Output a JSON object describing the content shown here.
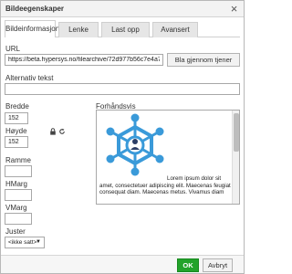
{
  "dialog": {
    "title": "Bildeegenskaper",
    "close_glyph": "×"
  },
  "tabs": [
    {
      "label": "Bildeinformasjon",
      "active": true
    },
    {
      "label": "Lenke",
      "active": false
    },
    {
      "label": "Last opp",
      "active": false
    },
    {
      "label": "Avansert",
      "active": false
    }
  ],
  "url": {
    "label": "URL",
    "value": "https://beta.hypersys.no/filearchive/72d977b56c7e4a7da0e8",
    "browse_label": "Bla gjennom tjener"
  },
  "alt": {
    "label": "Alternativ tekst",
    "value": ""
  },
  "width": {
    "label": "Bredde",
    "value": "152"
  },
  "height": {
    "label": "Høyde",
    "value": "152"
  },
  "lock_icon": "lock-icon",
  "reset_icon": "reset-icon",
  "border": {
    "label": "Ramme",
    "value": ""
  },
  "hspace": {
    "label": "HMarg",
    "value": ""
  },
  "vspace": {
    "label": "VMarg",
    "value": ""
  },
  "align": {
    "label": "Juster",
    "selected": "<ikke satt>"
  },
  "preview": {
    "label": "Forhåndsvis",
    "text_first": "Lorem ipsum dolor sit",
    "text_rest": "amet, consectetuer adipiscing elit. Maecenas feugiat consequat diam. Maecenas metus. Vivamus diam",
    "image_color": "#3a9ad9"
  },
  "footer": {
    "ok_label": "OK",
    "cancel_label": "Avbryt"
  },
  "colors": {
    "ok_bg": "#22a32a",
    "logo_blue": "#3a9ad9"
  }
}
